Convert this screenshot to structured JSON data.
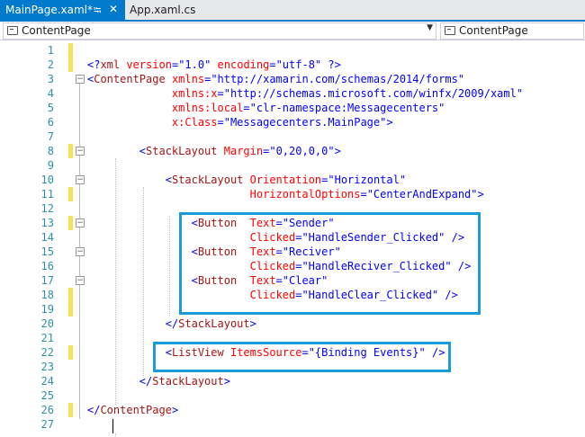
{
  "tabs": [
    {
      "label": "MainPage.xaml*",
      "active": true
    },
    {
      "label": "App.xaml.cs",
      "active": false
    }
  ],
  "nav": {
    "left": "ContentPage",
    "right": "ContentPage"
  },
  "lines": [
    {
      "n": "1",
      "text": ""
    },
    {
      "n": "2",
      "text": "<?xml version=\"1.0\" encoding=\"utf-8\" ?>"
    },
    {
      "n": "3",
      "text": "<ContentPage xmlns=\"http://xamarin.com/schemas/2014/forms\""
    },
    {
      "n": "4",
      "text": "             xmlns:x=\"http://schemas.microsoft.com/winfx/2009/xaml\""
    },
    {
      "n": "5",
      "text": "             xmlns:local=\"clr-namespace:Messagecenters\""
    },
    {
      "n": "6",
      "text": "             x:Class=\"Messagecenters.MainPage\">"
    },
    {
      "n": "7",
      "text": ""
    },
    {
      "n": "8",
      "text": "        <StackLayout Margin=\"0,20,0,0\">"
    },
    {
      "n": "9",
      "text": ""
    },
    {
      "n": "10",
      "text": "            <StackLayout Orientation=\"Horizontal\""
    },
    {
      "n": "11",
      "text": "                         HorizontalOptions=\"CenterAndExpand\">"
    },
    {
      "n": "12",
      "text": ""
    },
    {
      "n": "13",
      "text": "                <Button  Text=\"Sender\""
    },
    {
      "n": "14",
      "text": "                         Clicked=\"HandleSender_Clicked\" />"
    },
    {
      "n": "15",
      "text": "                <Button  Text=\"Reciver\""
    },
    {
      "n": "16",
      "text": "                         Clicked=\"HandleReciver_Clicked\" />"
    },
    {
      "n": "17",
      "text": "                <Button  Text=\"Clear\""
    },
    {
      "n": "18",
      "text": "                         Clicked=\"HandleClear_Clicked\" />"
    },
    {
      "n": "19",
      "text": ""
    },
    {
      "n": "20",
      "text": "            </StackLayout>"
    },
    {
      "n": "21",
      "text": ""
    },
    {
      "n": "22",
      "text": "            <ListView ItemsSource=\"{Binding Events}\" />"
    },
    {
      "n": "23",
      "text": ""
    },
    {
      "n": "24",
      "text": "        </StackLayout>"
    },
    {
      "n": "25",
      "text": ""
    },
    {
      "n": "26",
      "text": "</ContentPage>"
    },
    {
      "n": "27",
      "text": ""
    }
  ],
  "modified_lines": [
    "1",
    "2",
    "8",
    "11",
    "13",
    "18",
    "19",
    "22",
    "26"
  ],
  "fold_lines": [
    "3",
    "8",
    "10",
    "13",
    "15",
    "17"
  ],
  "colors": {
    "accent": "#007acc",
    "highlight_box": "#1a9ad6",
    "line_number": "#2b91af",
    "modified_marker": "#f2e35f",
    "xml_delimiter": "#0000ff",
    "xml_tag": "#a31515",
    "xml_attribute": "#ff0000",
    "xml_value": "#0000ff"
  }
}
